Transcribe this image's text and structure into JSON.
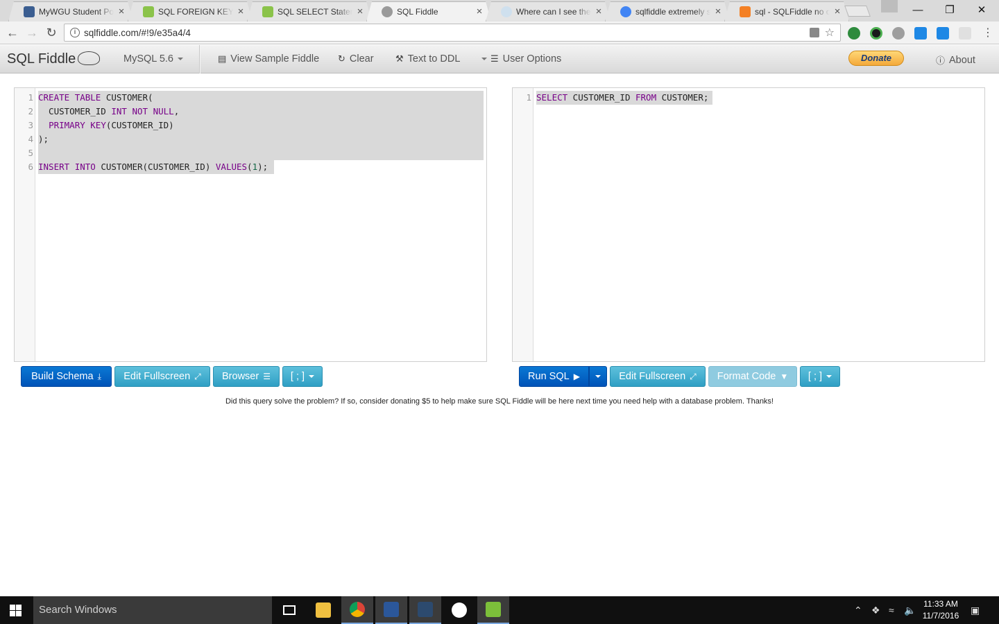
{
  "browser": {
    "tabs": [
      {
        "title": "MyWGU Student Portal",
        "favicon_color": "#3b5e91",
        "active": false
      },
      {
        "title": "SQL FOREIGN KEY Constraint",
        "favicon_color": "#8bc34a",
        "active": false
      },
      {
        "title": "SQL SELECT Statement",
        "favicon_color": "#8bc34a",
        "active": false
      },
      {
        "title": "SQL Fiddle",
        "favicon_color": "#9a9a9a",
        "active": true
      },
      {
        "title": "Where can I see the output",
        "favicon_color": "#cfe0ee",
        "active": false
      },
      {
        "title": "sqlfiddle extremely slow",
        "favicon_color": "#4285f4",
        "active": false
      },
      {
        "title": "sql - SQLFiddle no output",
        "favicon_color": "#f48024",
        "active": false
      }
    ],
    "close_glyph": "×",
    "url": "sqlfiddle.com/#!9/e35a4/4"
  },
  "app": {
    "brand": "SQL Fiddle",
    "db_select": "MySQL 5.6",
    "nav": {
      "view_sample": "View Sample Fiddle",
      "clear": "Clear",
      "text_to_ddl": "Text to DDL",
      "user_options": "User Options",
      "donate": "Donate",
      "about": "About"
    }
  },
  "schema_panel": {
    "line_numbers": [
      "1",
      "2",
      "3",
      "4",
      "5",
      "6"
    ],
    "buttons": {
      "build_schema": "Build Schema",
      "edit_fullscreen": "Edit Fullscreen",
      "browser": "Browser",
      "delimiter": "[ ; ]"
    }
  },
  "query_panel": {
    "line_numbers": [
      "1"
    ],
    "buttons": {
      "run_sql": "Run SQL",
      "edit_fullscreen": "Edit Fullscreen",
      "format_code": "Format Code",
      "delimiter": "[ ; ]"
    }
  },
  "donate_note": "Did this query solve the problem? If so, consider donating $5 to help make sure SQL Fiddle will be here next time you need help with a database problem. Thanks!",
  "taskbar": {
    "search_placeholder": "Search Windows",
    "time": "11:33 AM",
    "date": "11/7/2016"
  }
}
